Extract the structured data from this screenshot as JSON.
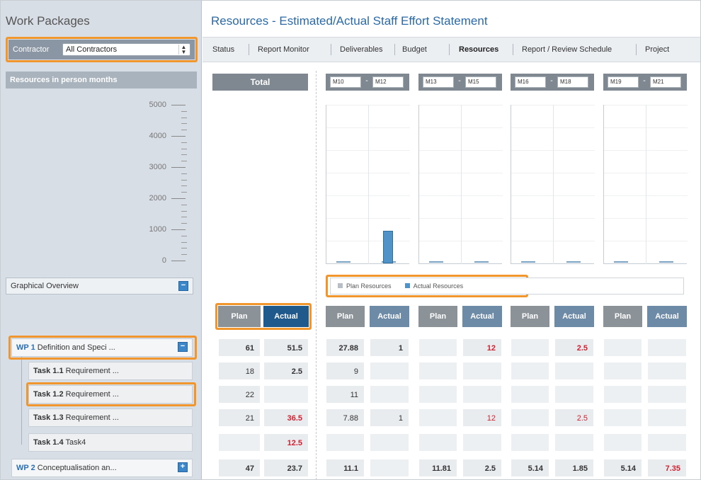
{
  "sidebar": {
    "title": "Work Packages",
    "contractor": {
      "label": "Contractor",
      "value": "All Contractors"
    },
    "resources_header": "Resources in person months",
    "y_ticks": [
      "5000",
      "4000",
      "3000",
      "2000",
      "1000",
      "0"
    ],
    "graphical_overview": "Graphical Overview",
    "items": [
      {
        "num": "WP 1",
        "label": "Definition and Speci ...",
        "type": "wp"
      },
      {
        "num": "Task 1.1",
        "label": "Requirement ...",
        "type": "task"
      },
      {
        "num": "Task 1.2",
        "label": "Requirement ...",
        "type": "task"
      },
      {
        "num": "Task 1.3",
        "label": "Requirement ...",
        "type": "task"
      },
      {
        "num": "Task 1.4",
        "label": "Task4",
        "type": "task"
      },
      {
        "num": "WP 2",
        "label": "Conceptualisation an...",
        "type": "wp"
      }
    ]
  },
  "main": {
    "title": "Resources - Estimated/Actual Staff Effort Statement",
    "tabs": [
      "Status",
      "Report Monitor",
      "Deliverables",
      "Budget",
      "Resources",
      "Report / Review Schedule",
      "Project"
    ],
    "active_tab": "Resources",
    "total_label": "Total",
    "periods": [
      {
        "from": "M10",
        "to": "M12"
      },
      {
        "from": "M13",
        "to": "M15"
      },
      {
        "from": "M16",
        "to": "M18"
      },
      {
        "from": "M19",
        "to": "M21"
      }
    ],
    "legend": {
      "plan": "Plan Resources",
      "actual": "Actual Resources"
    },
    "col_plan": "Plan",
    "col_actual": "Actual",
    "total_rows": [
      {
        "plan": "61",
        "actual": "51.5"
      },
      {
        "plan": "18",
        "actual": "2.5"
      },
      {
        "plan": "22",
        "actual": ""
      },
      {
        "plan": "21",
        "actual": "36.5"
      },
      {
        "plan": "",
        "actual": "12.5"
      },
      {
        "plan": "47",
        "actual": "23.7"
      }
    ],
    "period_rows": [
      [
        {
          "plan": "27.88",
          "actual": "1"
        },
        {
          "plan": "",
          "actual": "12"
        },
        {
          "plan": "",
          "actual": "2.5"
        },
        {
          "plan": "",
          "actual": ""
        }
      ],
      [
        {
          "plan": "9",
          "actual": ""
        },
        {
          "plan": "",
          "actual": ""
        },
        {
          "plan": "",
          "actual": ""
        },
        {
          "plan": "",
          "actual": ""
        }
      ],
      [
        {
          "plan": "11",
          "actual": ""
        },
        {
          "plan": "",
          "actual": ""
        },
        {
          "plan": "",
          "actual": ""
        },
        {
          "plan": "",
          "actual": ""
        }
      ],
      [
        {
          "plan": "7.88",
          "actual": "1"
        },
        {
          "plan": "",
          "actual": "12"
        },
        {
          "plan": "",
          "actual": "2.5"
        },
        {
          "plan": "",
          "actual": ""
        }
      ],
      [
        {
          "plan": "",
          "actual": ""
        },
        {
          "plan": "",
          "actual": ""
        },
        {
          "plan": "",
          "actual": ""
        },
        {
          "plan": "",
          "actual": ""
        }
      ],
      [
        {
          "plan": "11.1",
          "actual": ""
        },
        {
          "plan": "11.81",
          "actual": "2.5"
        },
        {
          "plan": "5.14",
          "actual": "1.85"
        },
        {
          "plan": "5.14",
          "actual": "7.35"
        }
      ]
    ]
  },
  "colors": {
    "accent_blue": "#2a6aa8",
    "highlight_orange": "#f0962d",
    "red_value": "#d22030"
  }
}
